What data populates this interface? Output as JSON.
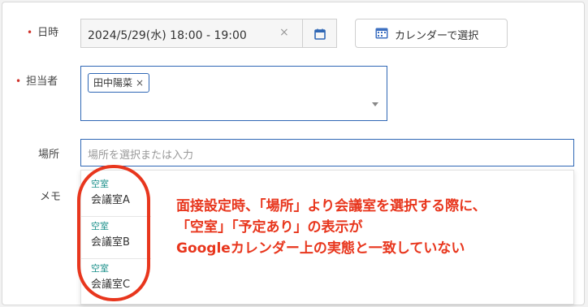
{
  "form": {
    "datetime": {
      "label": "日時",
      "value": "2024/5/29(水) 18:00 - 19:00",
      "clear": "×",
      "calendar_button_label": "カレンダーで選択"
    },
    "assignee": {
      "label": "担当者",
      "tag": "田中陽菜",
      "tag_remove": "×"
    },
    "place": {
      "label": "場所",
      "placeholder": "場所を選択または入力"
    },
    "memo": {
      "label": "メモ"
    },
    "required_mark": "•"
  },
  "dropdown": {
    "options": [
      {
        "status": "空室",
        "name": "会議室A"
      },
      {
        "status": "空室",
        "name": "会議室B"
      },
      {
        "status": "空室",
        "name": "会議室C"
      }
    ]
  },
  "annotation": {
    "lines": [
      "面接設定時、「場所」より会議室を選択する際に、",
      "「空室」「予定あり」の表示が",
      "Googleカレンダー上の実態と一致していない"
    ],
    "color": "#e8361d"
  },
  "colors": {
    "accent": "#2f67b5",
    "status_available": "#1a8f8a",
    "required": "#d0342c"
  }
}
